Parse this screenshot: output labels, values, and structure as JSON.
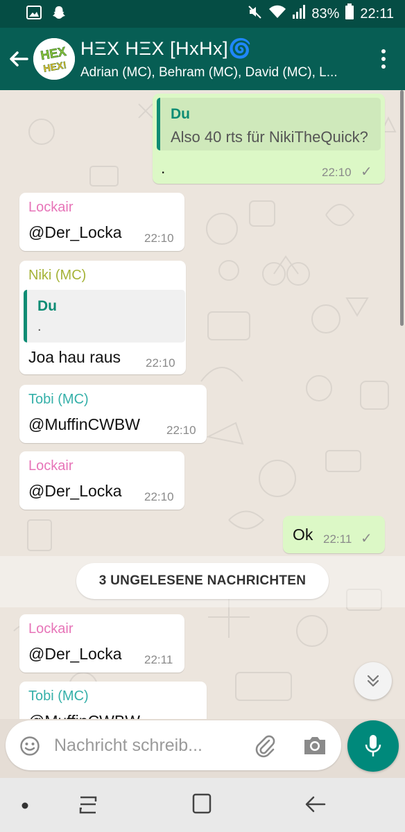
{
  "status_bar": {
    "battery": "83%",
    "time": "22:11"
  },
  "header": {
    "title": "HΞX HΞX [HxHx]🌀",
    "subtitle": "Adrian (MC), Behram (MC), David (MC), L...",
    "avatar_text_top": "HEX",
    "avatar_text_bottom": "HEX!"
  },
  "messages": [
    {
      "direction": "outgoing",
      "quote_name": "Du",
      "quote_text": "Also 40 rts für NikiTheQuick?",
      "text": ".",
      "time": "22:10"
    },
    {
      "direction": "incoming",
      "sender": "Lockair",
      "sender_color": "#e774b8",
      "text": "@Der_Locka",
      "time": "22:10"
    },
    {
      "direction": "incoming",
      "sender": "Niki (MC)",
      "sender_color": "#a5b338",
      "quote_name": "Du",
      "quote_text": ".",
      "text": "Joa hau raus",
      "time": "22:10"
    },
    {
      "direction": "incoming",
      "sender": "Tobi (MC)",
      "sender_color": "#35b0a9",
      "text": "@MuffinCWBW",
      "time": "22:10"
    },
    {
      "direction": "incoming",
      "sender": "Lockair",
      "sender_color": "#e774b8",
      "text": "@Der_Locka",
      "time": "22:10"
    },
    {
      "direction": "outgoing",
      "text": "Ok",
      "time": "22:11"
    },
    {
      "direction": "incoming",
      "sender": "Lockair",
      "sender_color": "#e774b8",
      "text": "@Der_Locka",
      "time": "22:11"
    },
    {
      "direction": "incoming",
      "sender": "Tobi (MC)",
      "sender_color": "#35b0a9",
      "text": "@MuffinCWBW"
    }
  ],
  "unread_divider": "3 UNGELESENE NACHRICHTEN",
  "composer": {
    "placeholder": "Nachricht schreib..."
  },
  "colors": {
    "header": "#075e54",
    "status_bar": "#054d44",
    "outgoing_bubble": "#dcf8c6",
    "quote_accent": "#0d8c74",
    "mic_button": "#00897b"
  },
  "icons": {
    "status_left": [
      "image-icon",
      "snapchat-icon"
    ],
    "status_right": [
      "mute-icon",
      "wifi-icon",
      "signal-icon",
      "battery-icon"
    ],
    "header": [
      "back-arrow-icon",
      "more-vert-icon"
    ],
    "composer": [
      "emoji-icon",
      "attach-icon",
      "camera-icon",
      "mic-icon"
    ],
    "nav": [
      "nav-dot-icon",
      "recent-apps-icon",
      "home-icon",
      "back-icon"
    ]
  }
}
